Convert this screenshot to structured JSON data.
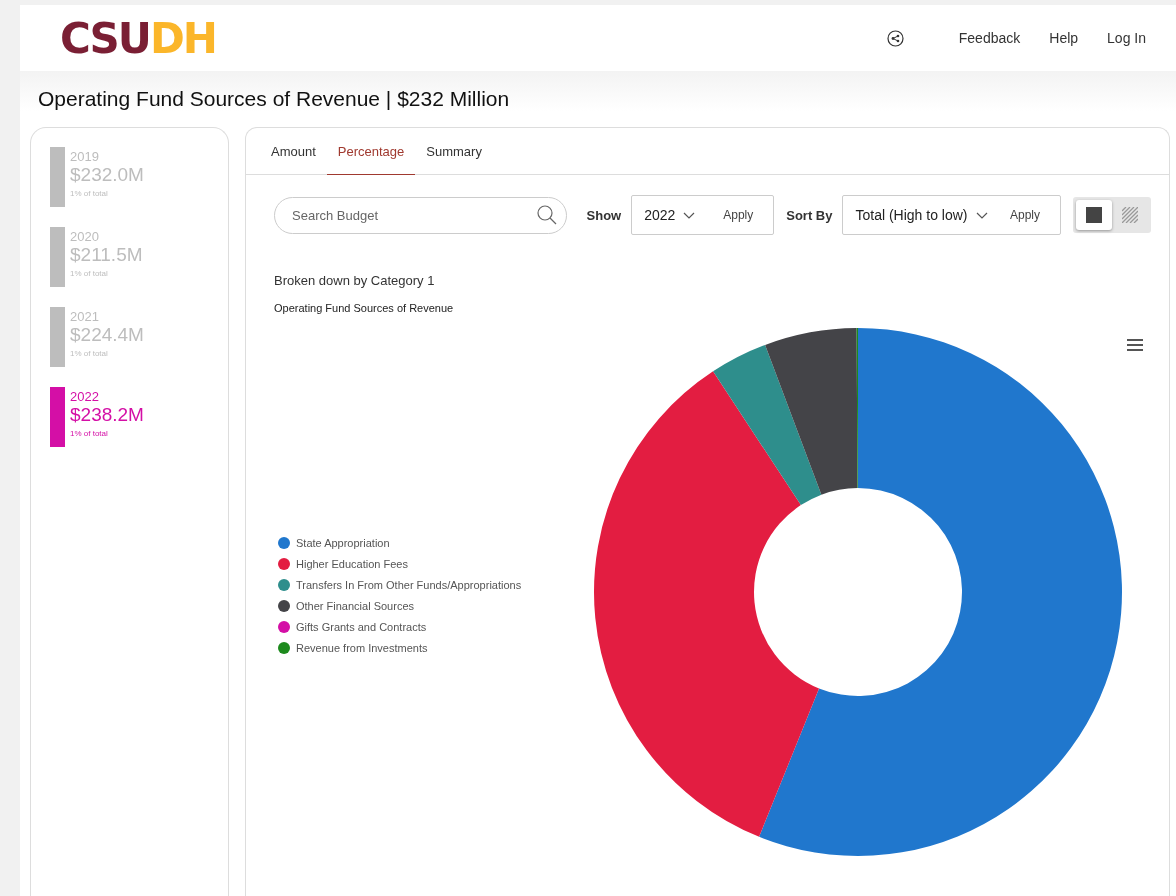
{
  "header": {
    "logo": {
      "part_1": "CSU",
      "part_2": "DH"
    },
    "links": [
      "Feedback",
      "Help",
      "Log In"
    ]
  },
  "page_title": "Operating Fund Sources of Revenue | $232 Million",
  "years": [
    {
      "year": "2019",
      "amount": "$232.0M",
      "share": "1% of total",
      "selected": false
    },
    {
      "year": "2020",
      "amount": "$211.5M",
      "share": "1% of total",
      "selected": false
    },
    {
      "year": "2021",
      "amount": "$224.4M",
      "share": "1% of total",
      "selected": false
    },
    {
      "year": "2022",
      "amount": "$238.2M",
      "share": "1% of total",
      "selected": true
    }
  ],
  "tabs": [
    {
      "label": "Amount",
      "selected": false
    },
    {
      "label": "Percentage",
      "selected": true
    },
    {
      "label": "Summary",
      "selected": false
    }
  ],
  "search": {
    "placeholder": "Search Budget"
  },
  "show": {
    "label": "Show",
    "value": "2022",
    "apply": "Apply"
  },
  "sort": {
    "label": "Sort By",
    "value": "Total (High to low)",
    "apply": "Apply"
  },
  "view_toggle": [
    {
      "kind": "solid",
      "selected": true
    },
    {
      "kind": "hatched",
      "selected": false
    }
  ],
  "breakdown_label": "Broken down by Category 1",
  "chart_title": "Operating Fund Sources of Revenue",
  "legend": [
    {
      "label": "State Appropriation",
      "color": "#2077cd"
    },
    {
      "label": "Higher Education Fees",
      "color": "#e31d41"
    },
    {
      "label": "Transfers In From Other Funds/Appropriations",
      "color": "#2e8e8c"
    },
    {
      "label": "Other Financial Sources",
      "color": "#444448"
    },
    {
      "label": "Gifts Grants and Contracts",
      "color": "#d40fa6"
    },
    {
      "label": "Revenue from Investments",
      "color": "#1d8a1d"
    }
  ]
}
